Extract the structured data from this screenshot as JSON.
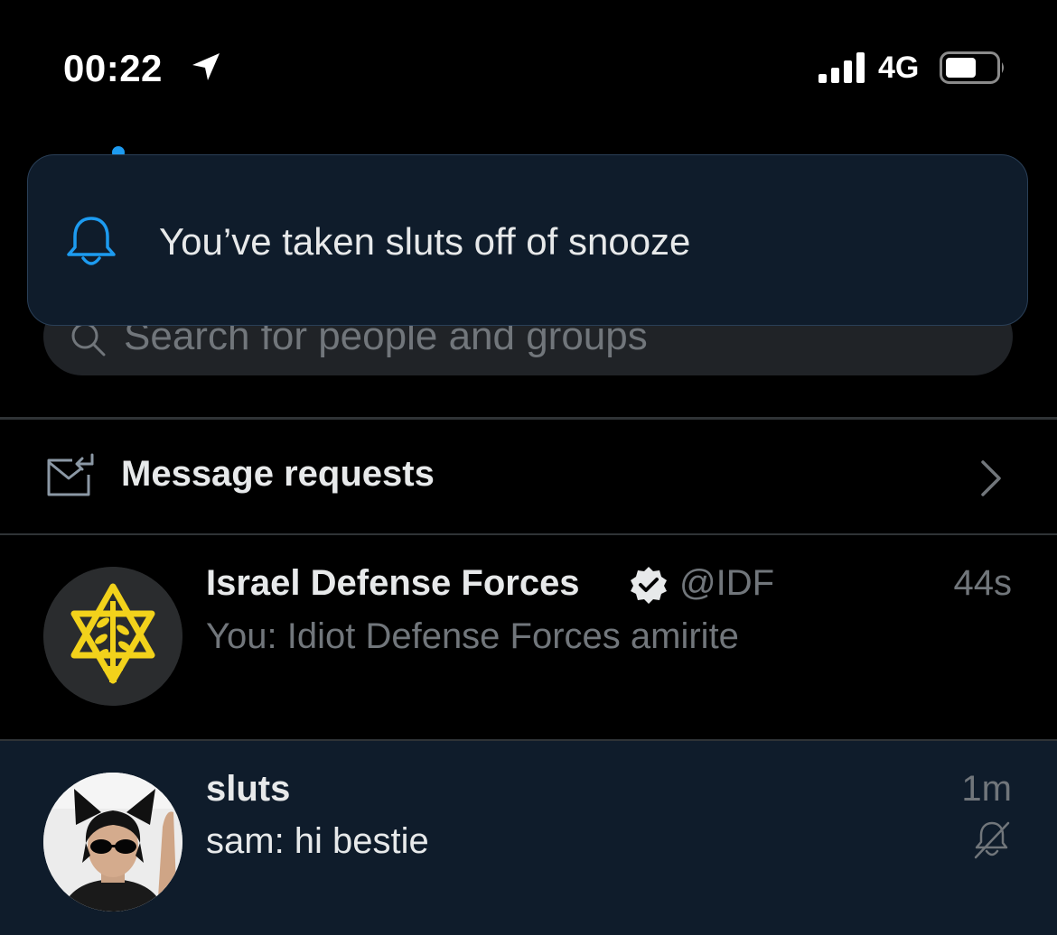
{
  "status_bar": {
    "time": "00:22",
    "network": "4G",
    "location_icon": "location-arrow-icon",
    "signal_icon": "cellular-signal-icon",
    "battery_icon": "battery-icon"
  },
  "toast": {
    "icon": "bell-icon",
    "text": "You’ve taken sluts off of snooze"
  },
  "search": {
    "icon": "search-icon",
    "placeholder": "Search for people and groups"
  },
  "message_requests": {
    "icon": "inbox-icon",
    "label": "Message requests",
    "chevron": "chevron-right-icon"
  },
  "conversations": [
    {
      "name": "Israel Defense Forces",
      "verified": true,
      "handle": "@IDF",
      "time": "44s",
      "preview": "You: Idiot Defense Forces amirite",
      "highlighted": false
    },
    {
      "name": "sluts",
      "time": "1m",
      "preview": "sam: hi bestie",
      "muted": true,
      "highlighted": true
    }
  ],
  "colors": {
    "background": "#000000",
    "accent": "#1d9bf0",
    "toast_bg": "#0f1c2b",
    "highlight_row": "#0f1c2b",
    "secondary_text": "#71767b",
    "primary_text": "#e7e9ea",
    "badge_yellow": "#f2d21b"
  }
}
